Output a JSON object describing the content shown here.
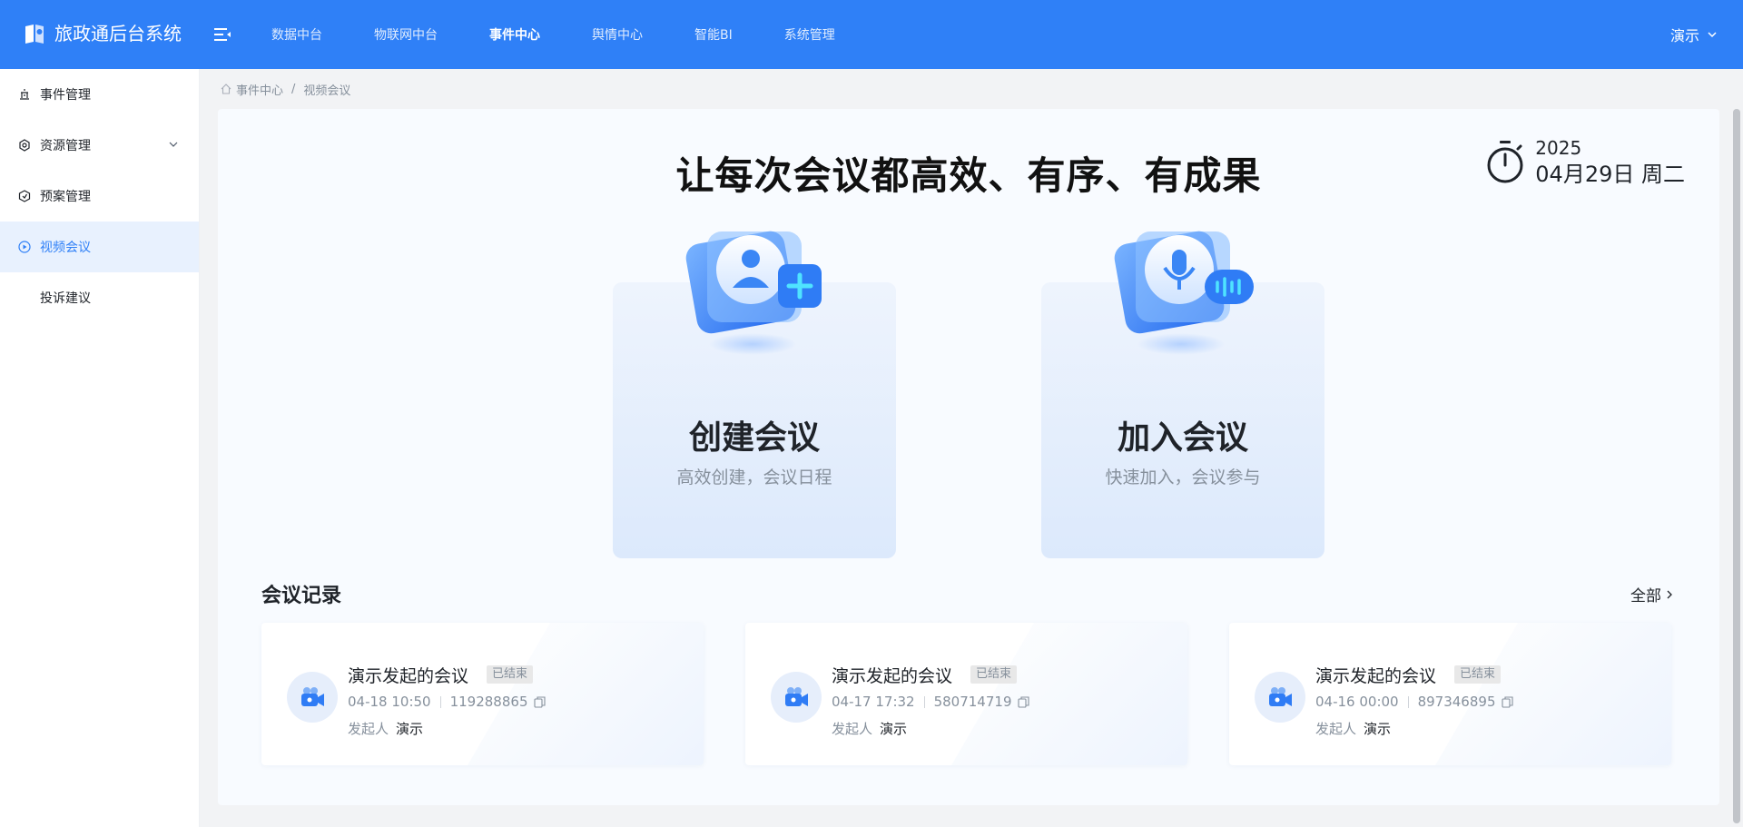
{
  "app": {
    "title": "旅政通后台系统"
  },
  "nav": {
    "items": [
      {
        "label": "数据中台",
        "active": false
      },
      {
        "label": "物联网中台",
        "active": false
      },
      {
        "label": "事件中心",
        "active": true
      },
      {
        "label": "舆情中心",
        "active": false
      },
      {
        "label": "智能BI",
        "active": false
      },
      {
        "label": "系统管理",
        "active": false
      }
    ]
  },
  "user": {
    "name": "演示"
  },
  "sidebar": {
    "items": [
      {
        "label": "事件管理",
        "icon": "event-icon"
      },
      {
        "label": "资源管理",
        "icon": "resource-icon",
        "expandable": true
      },
      {
        "label": "预案管理",
        "icon": "plan-icon"
      },
      {
        "label": "视频会议",
        "icon": "video-meeting-icon",
        "active": true
      },
      {
        "label": "投诉建议"
      }
    ]
  },
  "breadcrumb": {
    "home": "事件中心",
    "separator": "/",
    "current": "视频会议"
  },
  "main": {
    "headline": "让每次会议都高效、有序、有成果",
    "date": {
      "year": "2025",
      "day": "04月29日 周二"
    },
    "actions": [
      {
        "title": "创建会议",
        "subtitle": "高效创建，会议日程",
        "icon": "create-meeting-icon"
      },
      {
        "title": "加入会议",
        "subtitle": "快速加入，会议参与",
        "icon": "join-meeting-icon"
      }
    ],
    "records": {
      "title": "会议记录",
      "all_label": "全部",
      "items": [
        {
          "title": "演示发起的会议",
          "status": "已结束",
          "time": "04-18 10:50",
          "meeting_id": "119288865",
          "host_label": "发起人",
          "host": "演示"
        },
        {
          "title": "演示发起的会议",
          "status": "已结束",
          "time": "04-17 17:32",
          "meeting_id": "580714719",
          "host_label": "发起人",
          "host": "演示"
        },
        {
          "title": "演示发起的会议",
          "status": "已结束",
          "time": "04-16 00:00",
          "meeting_id": "897346895",
          "host_label": "发起人",
          "host": "演示"
        }
      ]
    }
  },
  "colors": {
    "primary": "#2f80f7",
    "active_bg": "#e8f1fe",
    "page_bg": "#f2f3f5"
  }
}
